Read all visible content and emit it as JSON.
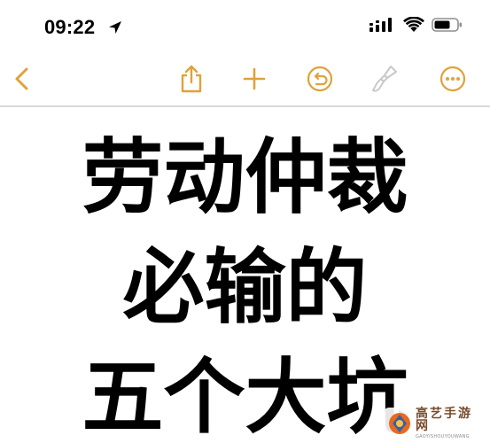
{
  "status_bar": {
    "time": "09:22",
    "location_icon": "location-arrow-icon",
    "signal_icon": "cellular-signal-icon",
    "wifi_icon": "wifi-icon",
    "battery_icon": "battery-icon"
  },
  "toolbar": {
    "back_icon": "chevron-left-icon",
    "share_icon": "share-icon",
    "add_icon": "plus-icon",
    "undo_icon": "undo-icon",
    "markup_icon": "paintbrush-icon",
    "more_icon": "more-ellipsis-icon",
    "accent_color": "#e0a23a",
    "disabled_color": "#c9c9c9"
  },
  "note": {
    "lines": [
      "劳动仲裁",
      "必输的",
      "五个大坑"
    ]
  },
  "watermark": {
    "title": "高艺手游网",
    "subtitle": "GAOYISHOUYOUWANG"
  }
}
